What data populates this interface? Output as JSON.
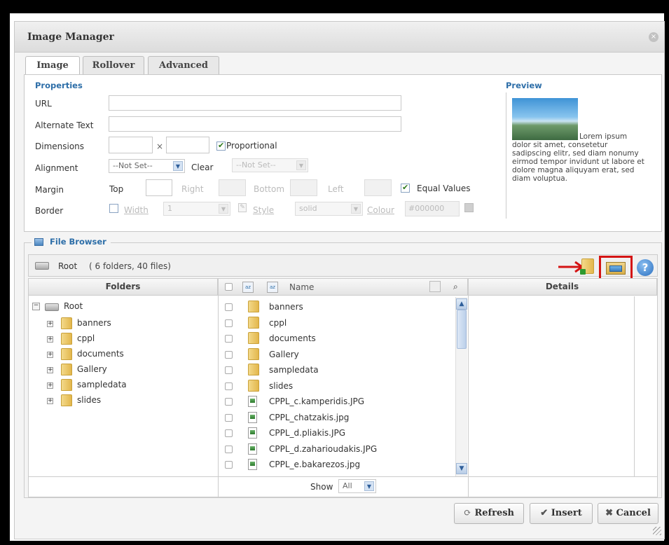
{
  "dialog": {
    "title": "Image Manager",
    "close_label": "×"
  },
  "tabs": [
    {
      "label": "Image"
    },
    {
      "label": "Rollover"
    },
    {
      "label": "Advanced"
    }
  ],
  "properties": {
    "section_title": "Properties",
    "url_label": "URL",
    "url_value": "",
    "alt_label": "Alternate Text",
    "alt_value": "",
    "dimensions_label": "Dimensions",
    "dimensions_sep": "×",
    "proportional_label": "Proportional",
    "alignment_label": "Alignment",
    "alignment_value": "--Not Set--",
    "clear_label": "Clear",
    "clear_value": "--Not Set--",
    "margin_label": "Margin",
    "top_label": "Top",
    "right_label": "Right",
    "bottom_label": "Bottom",
    "left_label": "Left",
    "equal_values_label": "Equal Values",
    "border_label": "Border",
    "width_label": "Width",
    "width_value": "1",
    "style_label": "Style",
    "style_value": "solid",
    "colour_label": "Colour",
    "colour_value": "#000000"
  },
  "preview": {
    "section_title": "Preview",
    "text": "Lorem ipsum dolor sit amet, consetetur sadipscing elitr, sed diam nonumy eirmod tempor invidunt ut labore et dolore magna aliquyam erat, sed diam voluptua."
  },
  "file_browser": {
    "legend": "File Browser",
    "path_root": "Root",
    "path_summary": "( 6 folders, 40 files)",
    "folders_header": "Folders",
    "name_header": "Name",
    "details_header": "Details",
    "tree_root": "Root",
    "tree": [
      "banners",
      "cppl",
      "documents",
      "Gallery",
      "sampledata",
      "slides"
    ],
    "folders": [
      "banners",
      "cppl",
      "documents",
      "Gallery",
      "sampledata",
      "slides"
    ],
    "files": [
      "CPPL_c.kamperidis.JPG",
      "CPPL_chatzakis.jpg",
      "CPPL_d.pliakis.JPG",
      "CPPL_d.zaharioudakis.JPG",
      "CPPL_e.bakarezos.jpg"
    ],
    "show_label": "Show",
    "show_value": "All"
  },
  "footer": {
    "refresh": "Refresh",
    "insert": "Insert",
    "cancel": "Cancel"
  },
  "colors": {
    "accent": "#2d6ea8",
    "highlight": "#d41414"
  }
}
